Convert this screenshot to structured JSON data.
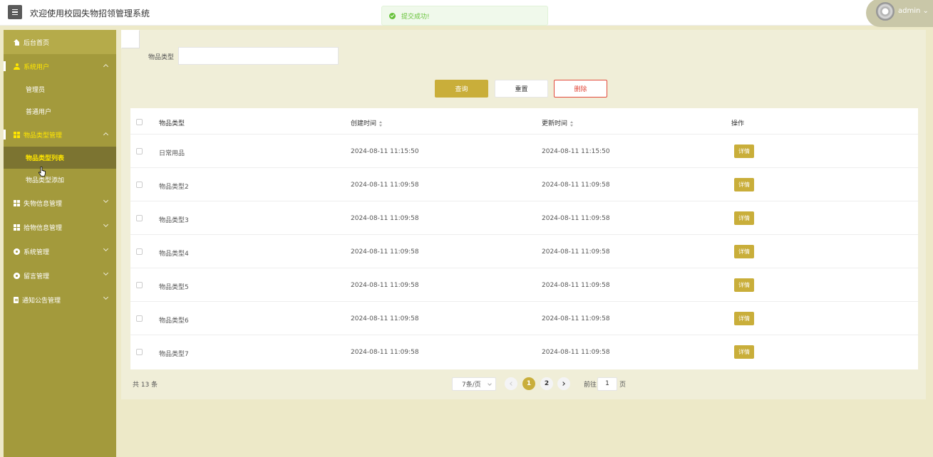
{
  "header": {
    "title": "欢迎使用校园失物招领管理系统",
    "user": "admin"
  },
  "toast": {
    "message": "提交成功!"
  },
  "sidebar": {
    "items": [
      {
        "label": "后台首页"
      },
      {
        "label": "系统用户",
        "children": [
          "管理员",
          "普通用户"
        ]
      },
      {
        "label": "物品类型管理",
        "children": [
          "物品类型列表",
          "物品类型添加"
        ]
      },
      {
        "label": "失物信息管理"
      },
      {
        "label": "拾物信息管理"
      },
      {
        "label": "系统管理"
      },
      {
        "label": "留言管理"
      },
      {
        "label": "通知公告管理"
      }
    ]
  },
  "filter": {
    "label": "物品类型",
    "value": ""
  },
  "buttons": {
    "query": "查询",
    "reset": "重置",
    "delete": "删除"
  },
  "table": {
    "headers": {
      "type": "物品类型",
      "created": "创建时间",
      "updated": "更新时间",
      "op": "操作"
    },
    "detail_label": "详情",
    "rows": [
      {
        "type": "日常用品",
        "created": "2024-08-11 11:15:50",
        "updated": "2024-08-11 11:15:50"
      },
      {
        "type": "物品类型2",
        "created": "2024-08-11 11:09:58",
        "updated": "2024-08-11 11:09:58"
      },
      {
        "type": "物品类型3",
        "created": "2024-08-11 11:09:58",
        "updated": "2024-08-11 11:09:58"
      },
      {
        "type": "物品类型4",
        "created": "2024-08-11 11:09:58",
        "updated": "2024-08-11 11:09:58"
      },
      {
        "type": "物品类型5",
        "created": "2024-08-11 11:09:58",
        "updated": "2024-08-11 11:09:58"
      },
      {
        "type": "物品类型6",
        "created": "2024-08-11 11:09:58",
        "updated": "2024-08-11 11:09:58"
      },
      {
        "type": "物品类型7",
        "created": "2024-08-11 11:09:58",
        "updated": "2024-08-11 11:09:58"
      }
    ]
  },
  "pagination": {
    "total": "共 13 条",
    "page_size": "7条/页",
    "pages": [
      "1",
      "2"
    ],
    "current": "1",
    "goto_label": "前往",
    "goto_value": "1",
    "goto_suffix": "页"
  },
  "colors": {
    "sidebar": "#a39a3c",
    "accent": "#c9ae3a",
    "active_text": "#ffe600",
    "danger": "#e24a3b",
    "success": "#67c23a"
  }
}
